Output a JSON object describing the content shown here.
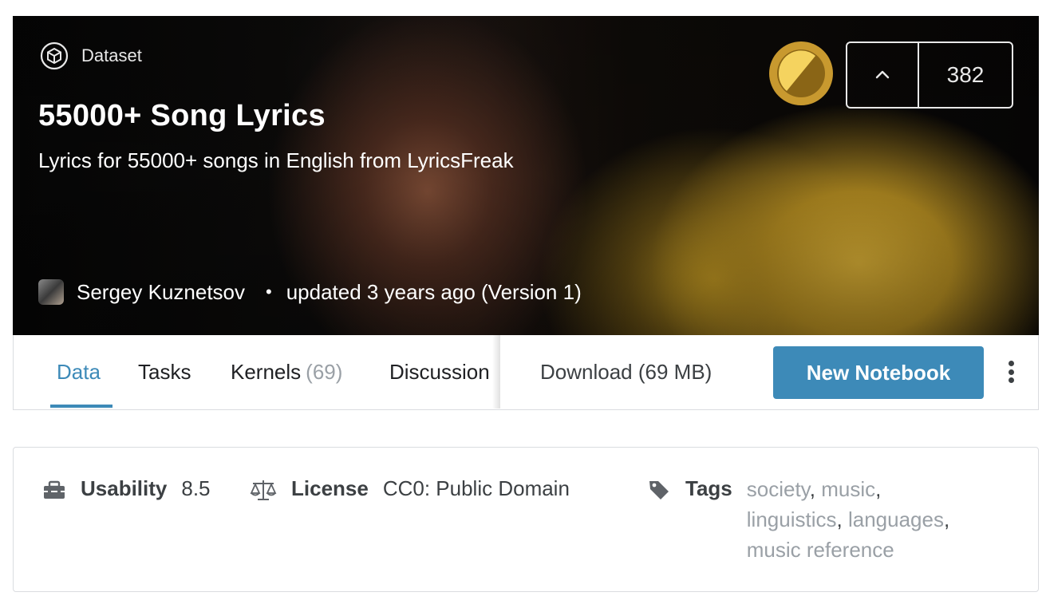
{
  "header": {
    "type_label": "Dataset",
    "title": "55000+ Song Lyrics",
    "subtitle": "Lyrics for 55000+ songs in English from LyricsFreak",
    "author": "Sergey Kuznetsov",
    "separator": "•",
    "updated": "updated 3 years ago (Version 1)",
    "vote_count": "382",
    "colors": {
      "medal_gold": "#c8992f",
      "medal_light": "#f5d35f"
    }
  },
  "tabs": [
    {
      "label": "Data",
      "count": ""
    },
    {
      "label": "Tasks",
      "count": ""
    },
    {
      "label": "Kernels",
      "count": "(69)"
    },
    {
      "label": "Discussion",
      "count": ""
    }
  ],
  "actions": {
    "download_label": "Download (69 MB)",
    "new_notebook_label": "New Notebook"
  },
  "meta": {
    "usability_label": "Usability",
    "usability_value": "8.5",
    "license_label": "License",
    "license_value": "CC0: Public Domain",
    "tags_label": "Tags",
    "tags": [
      "society",
      "music",
      "linguistics",
      "languages",
      "music reference"
    ],
    "tag_separator": ","
  },
  "colors": {
    "accent": "#3d8ab8",
    "tag_gray": "#9aa0a6"
  }
}
